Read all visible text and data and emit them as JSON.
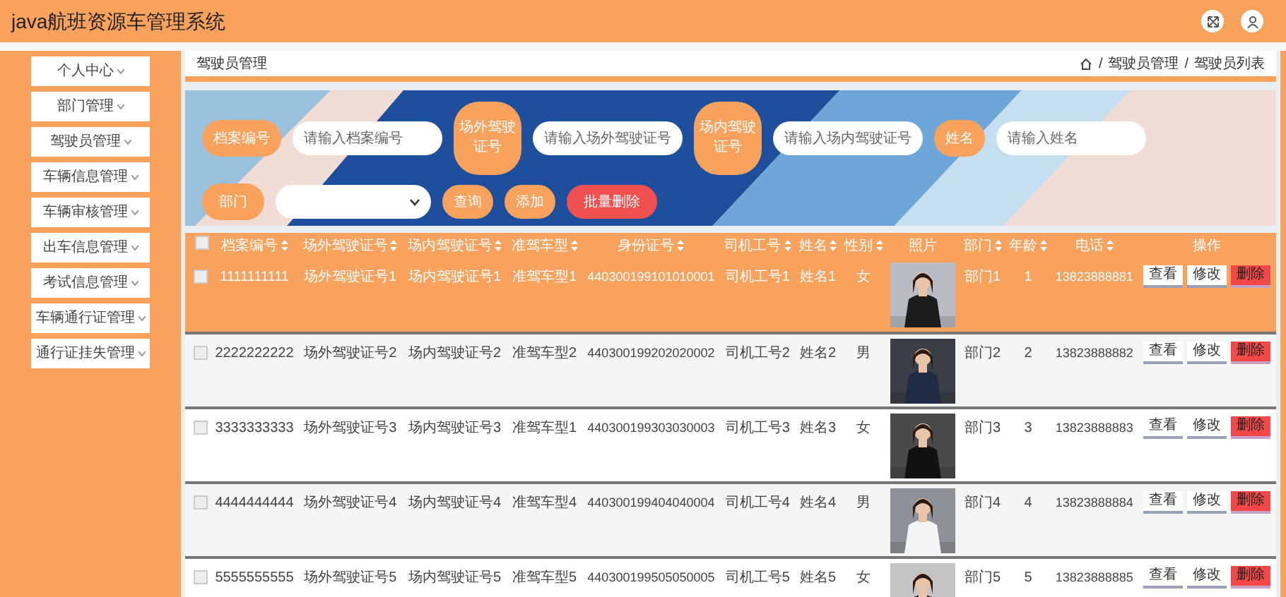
{
  "header": {
    "title": "java航班资源车管理系统"
  },
  "sidebar": {
    "items": [
      {
        "label": "个人中心"
      },
      {
        "label": "部门管理"
      },
      {
        "label": "驾驶员管理"
      },
      {
        "label": "车辆信息管理"
      },
      {
        "label": "车辆审核管理"
      },
      {
        "label": "出车信息管理"
      },
      {
        "label": "考试信息管理"
      },
      {
        "label": "车辆通行证管理"
      },
      {
        "label": "通行证挂失管理"
      }
    ]
  },
  "page": {
    "title": "驾驶员管理",
    "breadcrumb": [
      "驾驶员管理",
      "驾驶员列表"
    ],
    "separator": "/"
  },
  "search": {
    "fields": [
      {
        "label": "档案编号",
        "placeholder": "请输入档案编号"
      },
      {
        "label": "场外驾驶证号",
        "placeholder": "请输入场外驾驶证号"
      },
      {
        "label": "场内驾驶证号",
        "placeholder": "请输入场内驾驶证号"
      },
      {
        "label": "姓名",
        "placeholder": "请输入姓名"
      }
    ],
    "department": {
      "label": "部门"
    },
    "buttons": [
      {
        "label": "查询",
        "kind": "normal"
      },
      {
        "label": "添加",
        "kind": "normal"
      },
      {
        "label": "批量删除",
        "kind": "danger"
      }
    ]
  },
  "table": {
    "select_all": {
      "checked": false
    },
    "columns": [
      "档案编号",
      "场外驾驶证号",
      "场内驾驶证号",
      "准驾车型",
      "身份证号",
      "司机工号",
      "姓名",
      "性别",
      "照片",
      "部门",
      "年龄",
      "电话",
      "操作"
    ],
    "rows": [
      {
        "highlighted": true,
        "checked": false,
        "cells": [
          "1111111111",
          "场外驾驶证号1",
          "场内驾驶证号1",
          "准驾车型1",
          "440300199101010001",
          "司机工号1",
          "姓名1",
          "女"
        ],
        "photo": {
          "kind": "picture"
        },
        "cells2": [
          "部门1",
          "1",
          "13823888881"
        ],
        "actions": [
          {
            "label": "查看",
            "kind": "view"
          },
          {
            "label": "修改",
            "kind": "edit"
          },
          {
            "label": "删除",
            "kind": "delete"
          }
        ]
      },
      {
        "highlighted": false,
        "checked": false,
        "cells": [
          "2222222222",
          "场外驾驶证号2",
          "场内驾驶证号2",
          "准驾车型2",
          "440300199202020002",
          "司机工号2",
          "姓名2",
          "男"
        ],
        "photo": {
          "kind": "picture"
        },
        "cells2": [
          "部门2",
          "2",
          "13823888882"
        ],
        "actions": [
          {
            "label": "查看",
            "kind": "view"
          },
          {
            "label": "修改",
            "kind": "edit"
          },
          {
            "label": "删除",
            "kind": "delete"
          }
        ]
      },
      {
        "highlighted": false,
        "checked": false,
        "cells": [
          "3333333333",
          "场外驾驶证号3",
          "场内驾驶证号3",
          "准驾车型1",
          "440300199303030003",
          "司机工号3",
          "姓名3",
          "女"
        ],
        "photo": {
          "kind": "picture"
        },
        "cells2": [
          "部门3",
          "3",
          "13823888883"
        ],
        "actions": [
          {
            "label": "查看",
            "kind": "view"
          },
          {
            "label": "修改",
            "kind": "edit"
          },
          {
            "label": "删除",
            "kind": "delete"
          }
        ]
      },
      {
        "highlighted": false,
        "checked": false,
        "cells": [
          "4444444444",
          "场外驾驶证号4",
          "场内驾驶证号4",
          "准驾车型4",
          "440300199404040004",
          "司机工号4",
          "姓名4",
          "男"
        ],
        "photo": {
          "kind": "picture"
        },
        "cells2": [
          "部门4",
          "4",
          "13823888884"
        ],
        "actions": [
          {
            "label": "查看",
            "kind": "view"
          },
          {
            "label": "修改",
            "kind": "edit"
          },
          {
            "label": "删除",
            "kind": "delete"
          }
        ]
      },
      {
        "highlighted": false,
        "checked": false,
        "cells": [
          "5555555555",
          "场外驾驶证号5",
          "场内驾驶证号5",
          "准驾车型5",
          "440300199505050005",
          "司机工号5",
          "姓名5",
          "女"
        ],
        "photo": {
          "kind": "picture"
        },
        "cells2": [
          "部门5",
          "5",
          "13823888885"
        ],
        "actions": [
          {
            "label": "查看",
            "kind": "view"
          },
          {
            "label": "修改",
            "kind": "edit"
          },
          {
            "label": "删除",
            "kind": "delete"
          }
        ]
      }
    ]
  }
}
